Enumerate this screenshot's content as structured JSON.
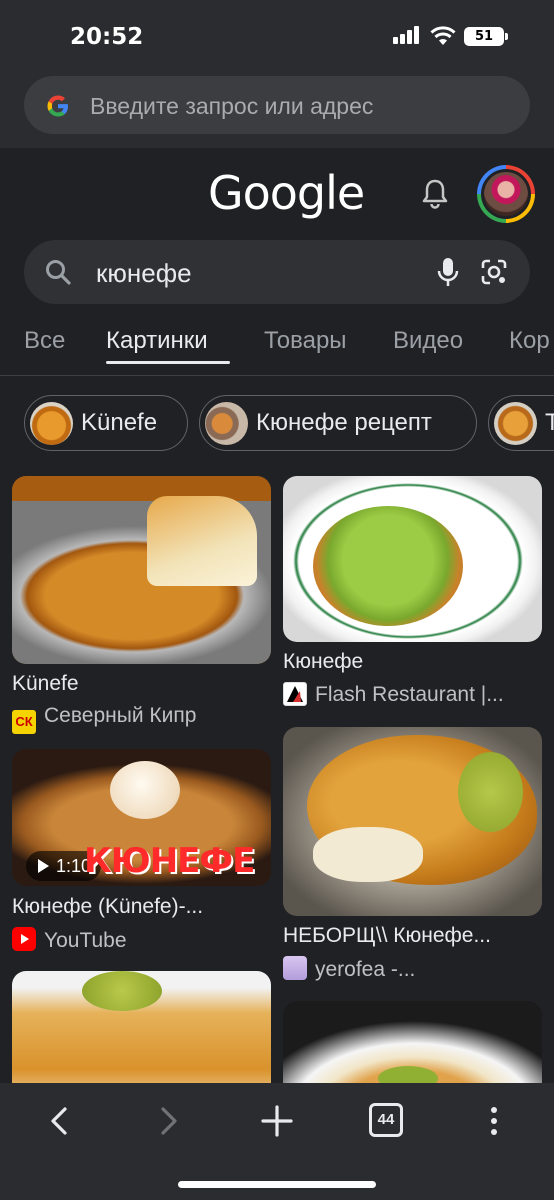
{
  "status": {
    "time": "20:52",
    "battery": "51"
  },
  "omnibox": {
    "placeholder": "Введите запрос или адрес"
  },
  "header": {
    "logo": "Google"
  },
  "search": {
    "query": "кюнефе"
  },
  "tabs": [
    {
      "label": "Все"
    },
    {
      "label": "Картинки"
    },
    {
      "label": "Товары"
    },
    {
      "label": "Видео"
    },
    {
      "label": "Кор"
    }
  ],
  "chips": [
    {
      "label": "Künefe"
    },
    {
      "label": "Кюнефе рецепт"
    },
    {
      "label": "Т"
    }
  ],
  "results": [
    {
      "title": "Künefe",
      "source": "Северный Кипр",
      "favicon_text": "СК"
    },
    {
      "title": "Кюнефе",
      "source": "Flash Restaurant |..."
    },
    {
      "title": "Кюнефе (Künefe)-...",
      "source": "YouTube",
      "duration": "1:10",
      "overlay": "КЮНЕФЕ"
    },
    {
      "title": "НЕБОРЩ\\\\ Кюнефе...",
      "source": "yerofea -..."
    }
  ],
  "toolbar": {
    "tab_count": "44"
  },
  "colors": {
    "background": "#202124",
    "surface": "#2b2c2f",
    "youtube": "#ff0000"
  }
}
